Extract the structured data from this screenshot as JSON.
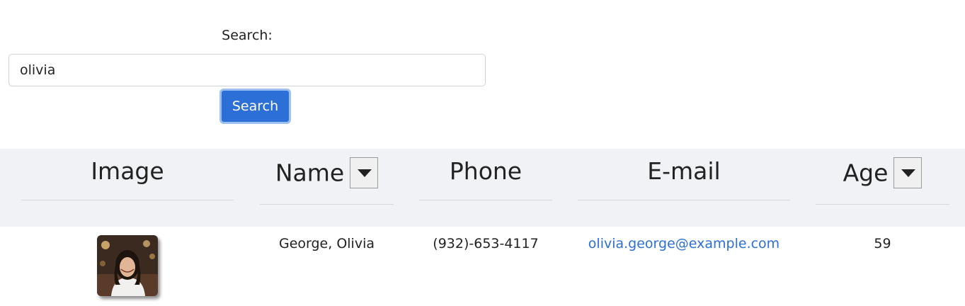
{
  "search": {
    "label": "Search:",
    "value": "olivia",
    "button_label": "Search"
  },
  "table": {
    "columns": [
      {
        "label": "Image",
        "sortable": false
      },
      {
        "label": "Name",
        "sortable": true
      },
      {
        "label": "Phone",
        "sortable": false
      },
      {
        "label": "E-mail",
        "sortable": false
      },
      {
        "label": "Age",
        "sortable": true
      }
    ],
    "rows": [
      {
        "image": "person-photo",
        "name": "George, Olivia",
        "phone": "(932)-653-4117",
        "email": "olivia.george@example.com",
        "age": "59"
      }
    ]
  },
  "colors": {
    "accent": "#2c6fd6",
    "header_bg": "#f1f2f6"
  }
}
